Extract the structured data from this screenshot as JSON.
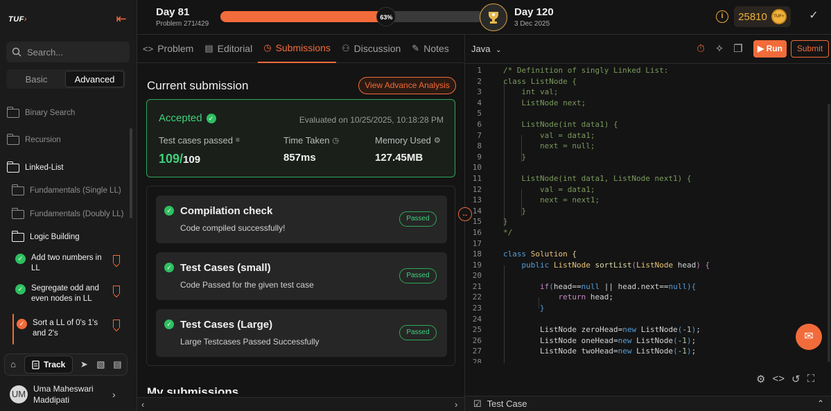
{
  "brand": {
    "logo": "TUF"
  },
  "sidebar": {
    "search_placeholder": "Search...",
    "modes": [
      "Basic",
      "Advanced"
    ],
    "active_mode": "Advanced",
    "items": [
      {
        "label": "Binary Search"
      },
      {
        "label": "Recursion"
      },
      {
        "label": "Linked-List"
      },
      {
        "label": "Fundamentals (Single LL)"
      },
      {
        "label": "Fundamentals (Doubly LL)"
      },
      {
        "label": "Logic Building"
      }
    ],
    "problems": [
      {
        "label": "Add two numbers in LL",
        "status": "solved"
      },
      {
        "label": "Segregate odd and even nodes in LL",
        "status": "solved"
      },
      {
        "label": "Sort a LL of 0's 1's and 2's",
        "status": "current"
      }
    ],
    "track_label": "Track",
    "user": {
      "initials": "UM",
      "name": "Uma Maheswari Maddipati"
    }
  },
  "topbar": {
    "day_current": "Day 81",
    "problem_count": "Problem 271/429",
    "progress_percent_label": "63%",
    "progress_fraction": 0.63,
    "day_target": "Day 120",
    "target_date": "3 Dec 2025",
    "coins": "25810",
    "coin_badge": "TUF+"
  },
  "tabs": [
    {
      "label": "Problem",
      "icon": "code-icon"
    },
    {
      "label": "Editorial",
      "icon": "document-icon"
    },
    {
      "label": "Submissions",
      "icon": "clock-icon"
    },
    {
      "label": "Discussion",
      "icon": "people-icon"
    },
    {
      "label": "Notes",
      "icon": "note-icon"
    }
  ],
  "active_tab": "Submissions",
  "submission": {
    "title": "Current submission",
    "analysis_button": "View Advance Analysis",
    "status": "Accepted",
    "evaluated_on": "Evaluated on 10/25/2025, 10:18:28 PM",
    "tests_label": "Test cases passed",
    "tests_passed": "109/",
    "tests_total": "109",
    "time_label": "Time Taken",
    "time_value": "857ms",
    "memory_label": "Memory Used",
    "memory_value": "127.45MB",
    "checks": [
      {
        "title": "Compilation check",
        "subtitle": "Code compiled successfully!",
        "badge": "Passed"
      },
      {
        "title": "Test Cases (small)",
        "subtitle": "Code Passed for the given test case",
        "badge": "Passed"
      },
      {
        "title": "Test Cases (Large)",
        "subtitle": "Large Testcases Passed Successfully",
        "badge": "Passed"
      }
    ],
    "my_submissions": "My submissions"
  },
  "editor": {
    "language": "Java",
    "run_label": "Run",
    "submit_label": "Submit",
    "test_case_label": "Test Case"
  },
  "colors": {
    "accent": "#f26b3a",
    "success": "#3fd07a"
  }
}
